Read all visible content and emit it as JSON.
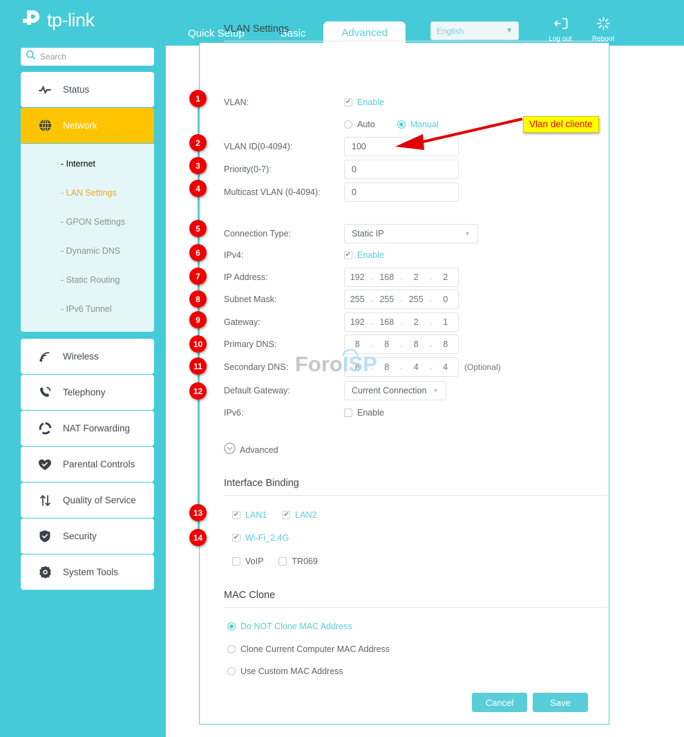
{
  "brand": {
    "name": "tp-link",
    "logo_icon": "tplink-logo-icon"
  },
  "header": {
    "tabs": [
      {
        "label": "Quick Setup",
        "active": false
      },
      {
        "label": "Basic",
        "active": false
      },
      {
        "label": "Advanced",
        "active": true
      }
    ],
    "language": {
      "value": "English",
      "caret_icon": "chevron-down-icon"
    },
    "logout": {
      "label": "Log out",
      "icon": "logout-icon"
    },
    "reboot": {
      "label": "Reboot",
      "icon": "reboot-icon"
    }
  },
  "sidebar": {
    "search": {
      "placeholder": "Search",
      "icon": "search-icon"
    },
    "items": [
      {
        "label": "Status",
        "icon": "status-pulse-icon",
        "active": false
      },
      {
        "label": "Network",
        "icon": "globe-icon",
        "active": true
      },
      {
        "label": "Wireless",
        "icon": "wifi-icon",
        "active": false
      },
      {
        "label": "Telephony",
        "icon": "phone-icon",
        "active": false
      },
      {
        "label": "NAT Forwarding",
        "icon": "nat-icon",
        "active": false
      },
      {
        "label": "Parental Controls",
        "icon": "heart-shield-icon",
        "active": false
      },
      {
        "label": "Quality of Service",
        "icon": "arrows-updown-icon",
        "active": false
      },
      {
        "label": "Security",
        "icon": "shield-check-icon",
        "active": false
      },
      {
        "label": "System Tools",
        "icon": "gear-icon",
        "active": false
      }
    ],
    "submenu": [
      {
        "label": "- Internet",
        "state": "current"
      },
      {
        "label": "- LAN Settings",
        "state": "selected"
      },
      {
        "label": "- GPON Settings",
        "state": "normal"
      },
      {
        "label": "- Dynamic DNS",
        "state": "normal"
      },
      {
        "label": "- Static Routing",
        "state": "normal"
      },
      {
        "label": "- IPv6 Tunnel",
        "state": "normal"
      }
    ]
  },
  "vlan_section": {
    "title": "VLAN Settings",
    "vlan_label": "VLAN:",
    "vlan_enable_label": "Enable",
    "vlan_enable_checked": true,
    "mode_auto_label": "Auto",
    "mode_manual_label": "Manual",
    "mode_selected": "Manual",
    "vlan_id_label": "VLAN ID(0-4094):",
    "vlan_id_value": "100",
    "priority_label": "Priority(0-7):",
    "priority_value": "0",
    "multicast_label": "Multicast VLAN (0-4094):",
    "multicast_value": "0"
  },
  "connection_section": {
    "conn_type_label": "Connection Type:",
    "conn_type_value": "Static IP",
    "ipv4_label": "IPv4:",
    "ipv4_enable_label": "Enable",
    "ipv4_enable_checked": true,
    "ip_address_label": "IP Address:",
    "ip_address_octets": [
      "192",
      "168",
      "2",
      "2"
    ],
    "subnet_label": "Subnet Mask:",
    "subnet_octets": [
      "255",
      "255",
      "255",
      "0"
    ],
    "gateway_label": "Gateway:",
    "gateway_octets": [
      "192",
      "168",
      "2",
      "1"
    ],
    "primary_dns_label": "Primary DNS:",
    "primary_dns_octets": [
      "8",
      "8",
      "8",
      "8"
    ],
    "secondary_dns_label": "Secondary DNS:",
    "secondary_dns_octets": [
      "8",
      "8",
      "4",
      "4"
    ],
    "secondary_dns_optional": "(Optional)",
    "default_gateway_label": "Default Gateway:",
    "default_gateway_value": "Current Connection",
    "ipv6_label": "IPv6:",
    "ipv6_enable_label": "Enable",
    "ipv6_enable_checked": false,
    "advanced_label": "Advanced",
    "advanced_icon": "chevron-down-circle-icon"
  },
  "interface_binding": {
    "title": "Interface Binding",
    "options": [
      {
        "label": "LAN1",
        "checked": true
      },
      {
        "label": "LAN2",
        "checked": true
      },
      {
        "label": "Wi-Fi_2.4G",
        "checked": true
      },
      {
        "label": "VoIP",
        "checked": false
      },
      {
        "label": "TR069",
        "checked": false
      }
    ]
  },
  "mac_clone": {
    "title": "MAC Clone",
    "options": [
      {
        "label": "Do NOT Clone MAC Address",
        "selected": true
      },
      {
        "label": "Clone Current Computer MAC Address",
        "selected": false
      },
      {
        "label": "Use Custom MAC Address",
        "selected": false
      }
    ]
  },
  "actions": {
    "cancel_label": "Cancel",
    "save_label": "Save"
  },
  "annotations": {
    "badges": [
      "1",
      "2",
      "3",
      "4",
      "5",
      "6",
      "7",
      "8",
      "9",
      "10",
      "11",
      "12",
      "13",
      "14"
    ],
    "callout_text": "Vlan del cliente",
    "callout_bg": "#FFFF00",
    "callout_color": "#EE0000",
    "arrow_icon": "red-arrow-icon"
  },
  "watermark": {
    "part1": "Foro",
    "part2": "ISP"
  },
  "colors": {
    "teal": "#45CBD8",
    "accent_teal": "#5BCDD8",
    "active_yellow": "#FFC400",
    "badge_red": "#EE0000"
  }
}
